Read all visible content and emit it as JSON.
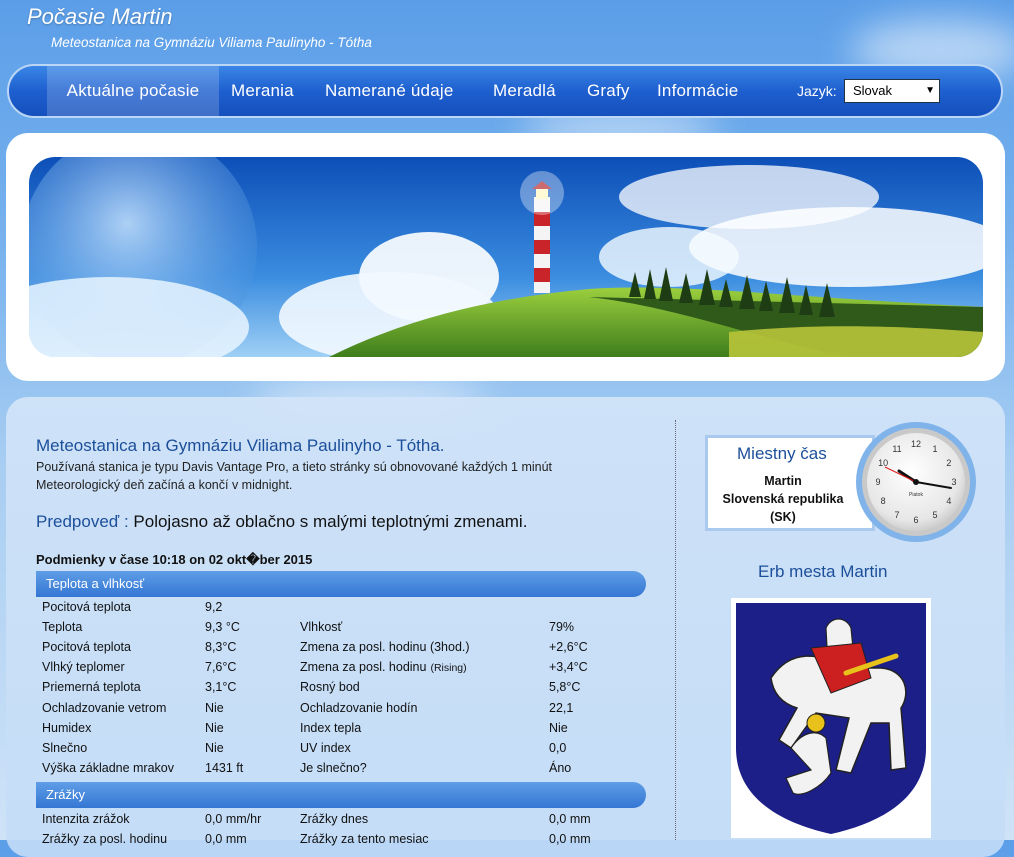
{
  "site": {
    "title": "Počasie Martin",
    "subtitle": "Meteostanica na Gymnáziu Viliama Paulinyho - Tótha"
  },
  "nav": {
    "items": [
      "Aktuálne počasie",
      "Merania",
      "Namerané údaje",
      "Meradlá",
      "Grafy",
      "Informácie"
    ],
    "active_index": 0,
    "language_label": "Jazyk:",
    "language_value": "Slovak"
  },
  "station": {
    "title": "Meteostanica na Gymnáziu Viliama Paulinyho - Tótha.",
    "desc_line1": "Používaná stanica je typu Davis Vantage Pro, a tieto stránky sú obnovované každých 1 minút",
    "desc_line2": "Meteorologický deň začíná a končí v midnight."
  },
  "forecast": {
    "label": "Predpoveď :",
    "value": "Polojasno až oblačno s malými teplotnými zmenami."
  },
  "conditions": {
    "header": "Podmienky v čase 10:18 on 02 okt�ber 2015"
  },
  "sections": {
    "temp_header": "Teplota a vlhkosť",
    "rain_header": "Zrážky"
  },
  "temp_rows": [
    {
      "l1": "Pocitová teplota",
      "v1": "9,2",
      "l2": "",
      "l2s": "",
      "v2": ""
    },
    {
      "l1": "Teplota",
      "v1": "9,3 °C",
      "l2": "Vlhkosť",
      "l2s": "",
      "v2": "79%"
    },
    {
      "l1": "Pocitová teplota",
      "v1": "8,3°C",
      "l2": "Zmena za posl. hodinu (3hod.)",
      "l2s": "",
      "v2": "+2,6°C"
    },
    {
      "l1": "Vlhký teplomer",
      "v1": "7,6°C",
      "l2": "Zmena za posl. hodinu",
      "l2s": "(Rising)",
      "v2": "+3,4°C"
    },
    {
      "l1": "Priemerná teplota",
      "v1": "3,1°C",
      "l2": "Rosný bod",
      "l2s": "",
      "v2": "5,8°C"
    },
    {
      "l1": "Ochladzovanie vetrom",
      "v1": "Nie",
      "l2": "Ochladzovanie hodín",
      "l2s": "",
      "v2": "22,1"
    },
    {
      "l1": "Humidex",
      "v1": "Nie",
      "l2": "Index tepla",
      "l2s": "",
      "v2": "Nie"
    },
    {
      "l1": "Slnečno",
      "v1": "Nie",
      "l2": "UV index",
      "l2s": "",
      "v2": "0,0"
    },
    {
      "l1": "Výška základne mrakov",
      "v1": "1431 ft",
      "l2": "Je slnečno?",
      "l2s": "",
      "v2": "Áno"
    }
  ],
  "rain_rows": [
    {
      "l1": "Intenzita zrážok",
      "v1": "0,0 mm/hr",
      "l2": "Zrážky dnes",
      "l2s": "",
      "v2": "0,0 mm"
    },
    {
      "l1": "Zrážky za posl. hodinu",
      "v1": "0,0 mm",
      "l2": "Zrážky za tento mesiac",
      "l2s": "",
      "v2": "0,0 mm"
    }
  ],
  "clock": {
    "title": "Miestny čas",
    "city": "Martin",
    "country": "Slovenská republika",
    "code": "(SK)",
    "day_label": "Piatok"
  },
  "erb": {
    "title": "Erb mesta Martin",
    "shield_color": "#1b1f87"
  },
  "colors": {
    "nav_blue": "#1e5fcf",
    "title_blue": "#1c4f9a",
    "section_bar": "#3477d4"
  }
}
